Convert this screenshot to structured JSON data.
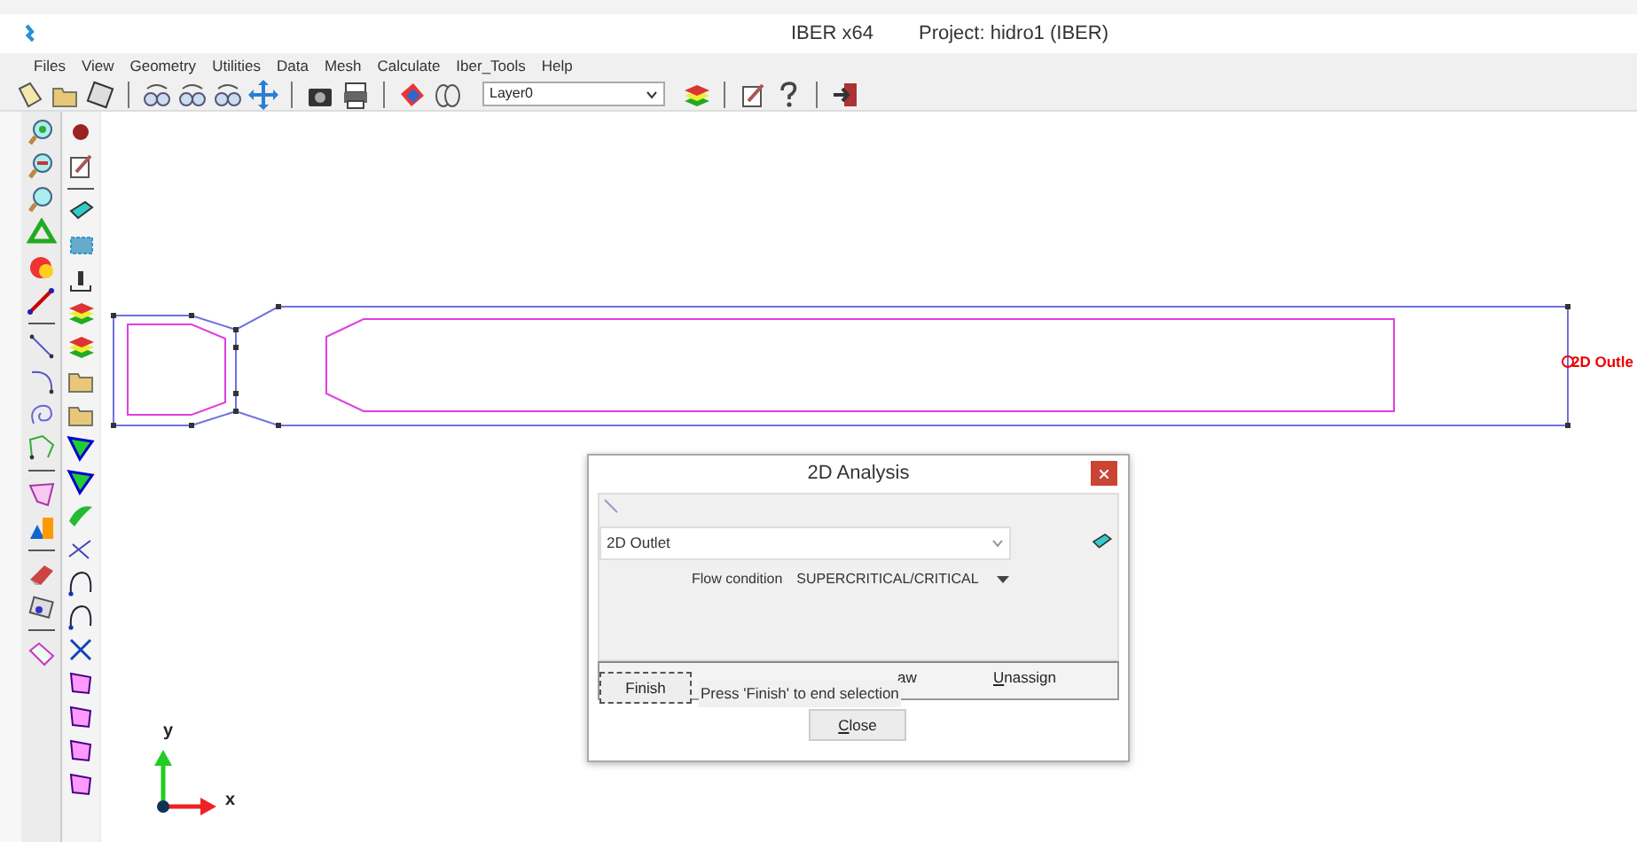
{
  "window": {
    "title": "IBER x64",
    "project": "Project: hidro1 (IBER)"
  },
  "menu": [
    "Files",
    "View",
    "Geometry",
    "Utilities",
    "Data",
    "Mesh",
    "Calculate",
    "Iber_Tools",
    "Help"
  ],
  "toolbar": {
    "layer": "Layer0"
  },
  "canvas": {
    "outlet_label": "2D Outle",
    "axis_x": "x",
    "axis_y": "y"
  },
  "dialog": {
    "title": "2D Analysis",
    "condition": "2D Outlet",
    "flow_label": "Flow condition",
    "flow_value": "SUPERCRITICAL/CRITICAL",
    "buttons": [
      {
        "label": "aw",
        "underline": false
      },
      {
        "label": "Unassign",
        "underline": true
      }
    ],
    "finish": "Finish",
    "hint": "Press 'Finish' to end selection",
    "close": "Close"
  }
}
